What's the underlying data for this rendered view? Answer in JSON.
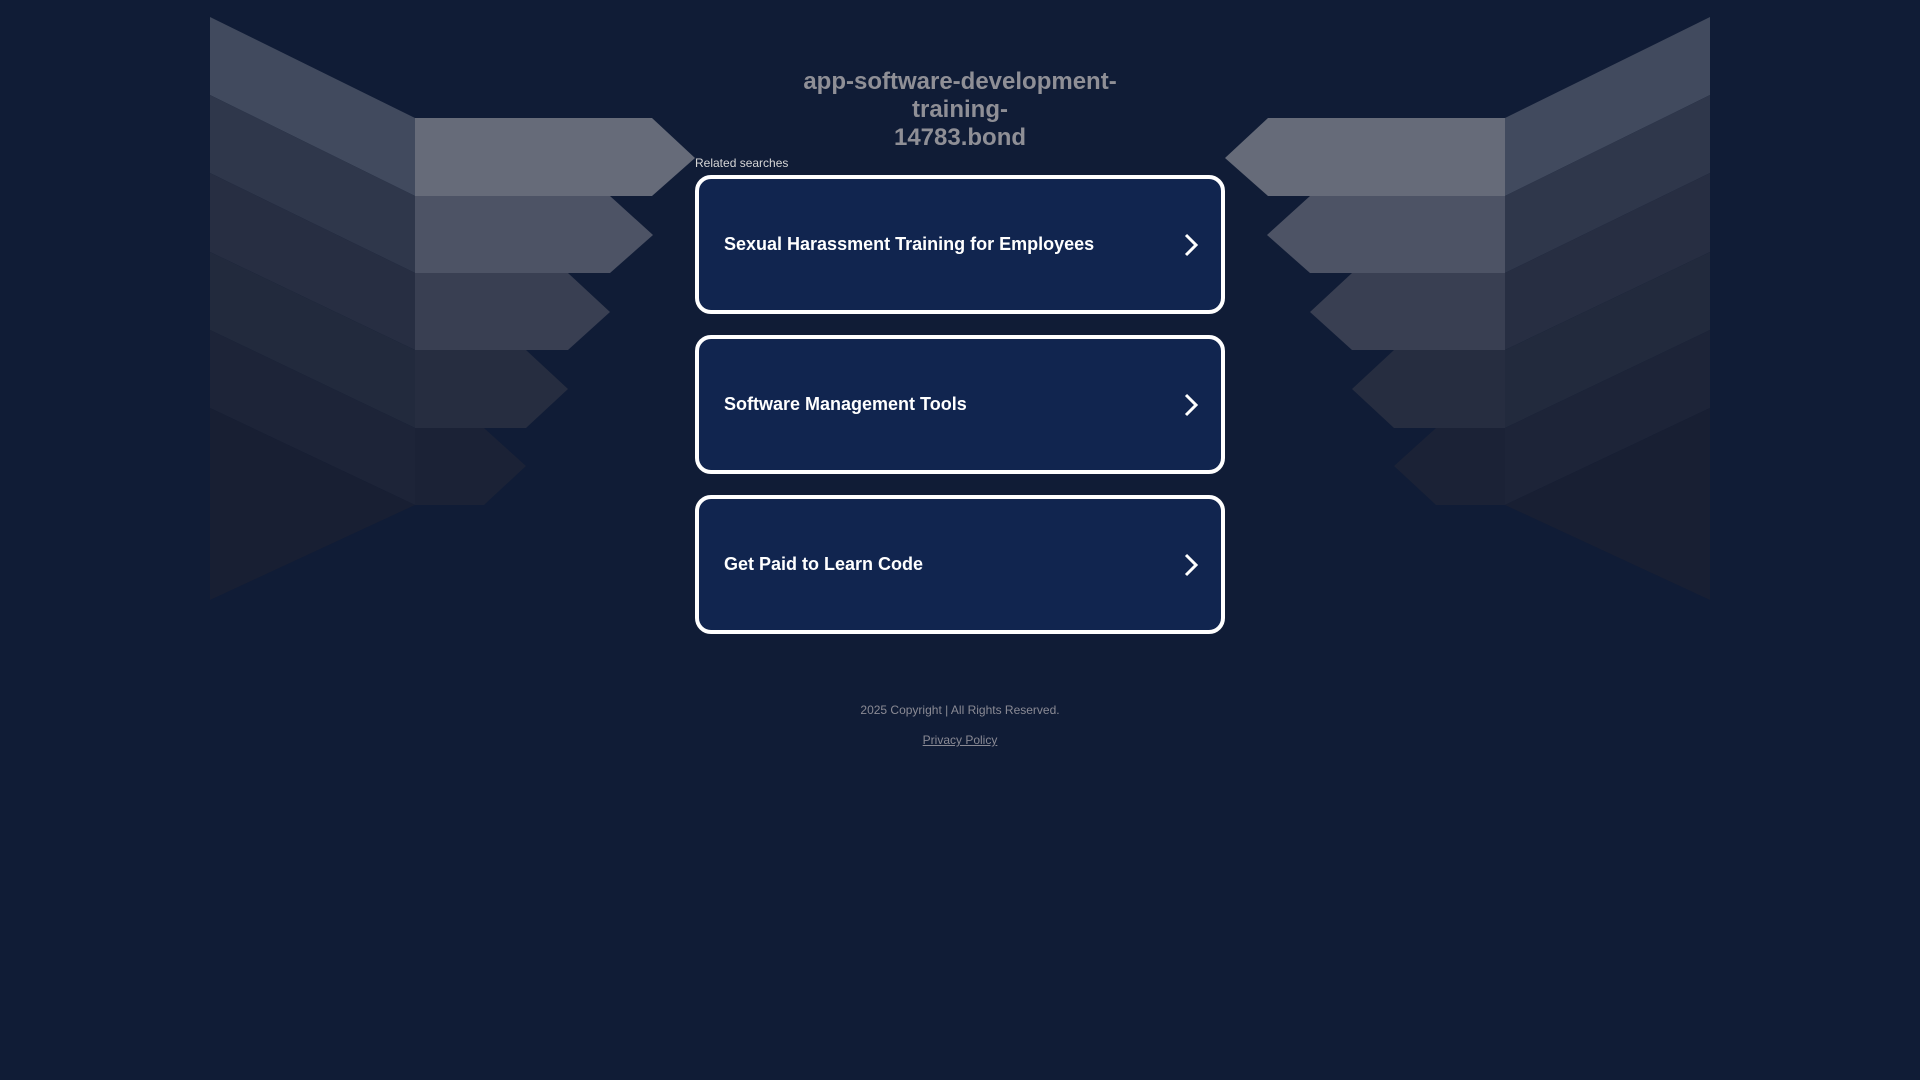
{
  "header": {
    "domain_line1": "app-software-development-training-",
    "domain_line2": "14783.bond"
  },
  "related": {
    "label": "Related searches",
    "items": [
      {
        "label": "Sexual Harassment Training for Employees",
        "icon": "chevron-right-icon"
      },
      {
        "label": "Software Management Tools",
        "icon": "chevron-right-icon"
      },
      {
        "label": "Get Paid to Learn Code",
        "icon": "chevron-right-icon"
      }
    ]
  },
  "footer": {
    "copyright": "2025 Copyright | All Rights Reserved.",
    "privacy": "Privacy Policy"
  },
  "colors": {
    "background": "#101c36",
    "card": "#11254f",
    "card_border": "#ffffff",
    "title": "#8f8f96"
  }
}
